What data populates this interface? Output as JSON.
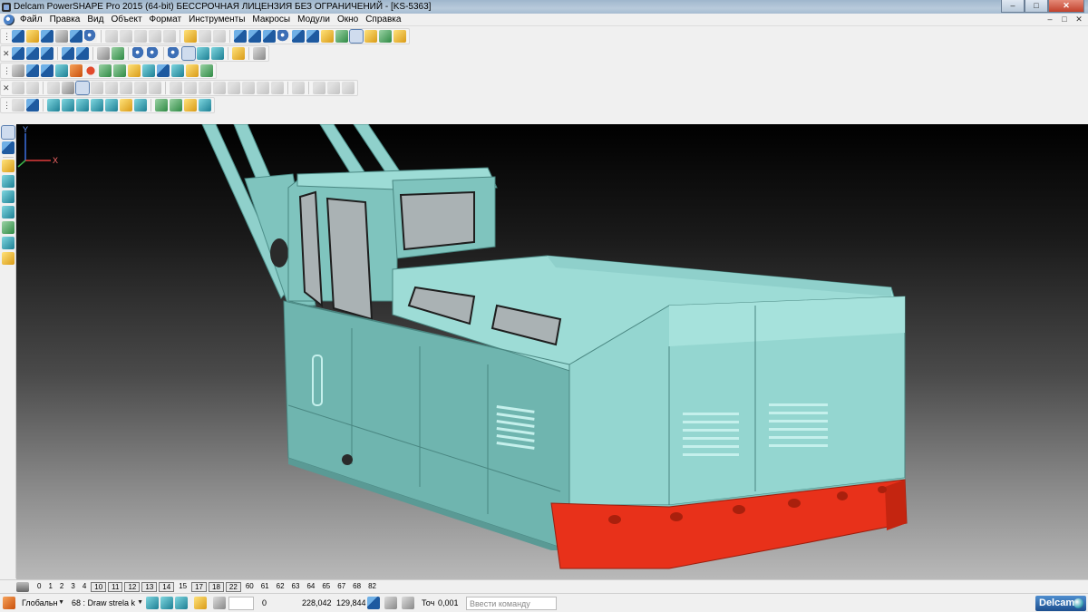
{
  "window": {
    "title": "Delcam PowerSHAPE Pro 2015 (64-bit) БЕССРОЧНАЯ ЛИЦЕНЗИЯ БЕЗ ОГРАНИЧЕНИЙ - [KS-5363]",
    "minimize": "–",
    "maximize": "□",
    "close": "✕"
  },
  "menu": {
    "items": [
      "Файл",
      "Правка",
      "Вид",
      "Объект",
      "Формат",
      "Инструменты",
      "Макросы",
      "Модули",
      "Окно",
      "Справка"
    ],
    "mdi_min": "–",
    "mdi_max": "□",
    "mdi_close": "✕"
  },
  "colors": {
    "body": "#7fc4be",
    "body_light": "#9ddcd6",
    "frame": "#e8311a",
    "window_glass": "#aab2b4"
  },
  "levels": {
    "items": [
      "0",
      "1",
      "2",
      "3",
      "4",
      "10",
      "11",
      "12",
      "13",
      "14",
      "15",
      "17",
      "18",
      "22",
      "60",
      "61",
      "62",
      "63",
      "64",
      "65",
      "67",
      "68",
      "82"
    ],
    "used": [
      "10",
      "11",
      "12",
      "13",
      "14",
      "17",
      "18",
      "22"
    ]
  },
  "status": {
    "workplane": "Глобальн",
    "level": "68 : Draw strela k",
    "pos_z": "0",
    "pos_x": "228,042",
    "pos_y": "129,844",
    "tolerance_label": "Точ",
    "tolerance": "0,001",
    "command_placeholder": "Ввести команду",
    "logo": "Delcam"
  },
  "triad": {
    "y": "Y",
    "x": "X"
  }
}
